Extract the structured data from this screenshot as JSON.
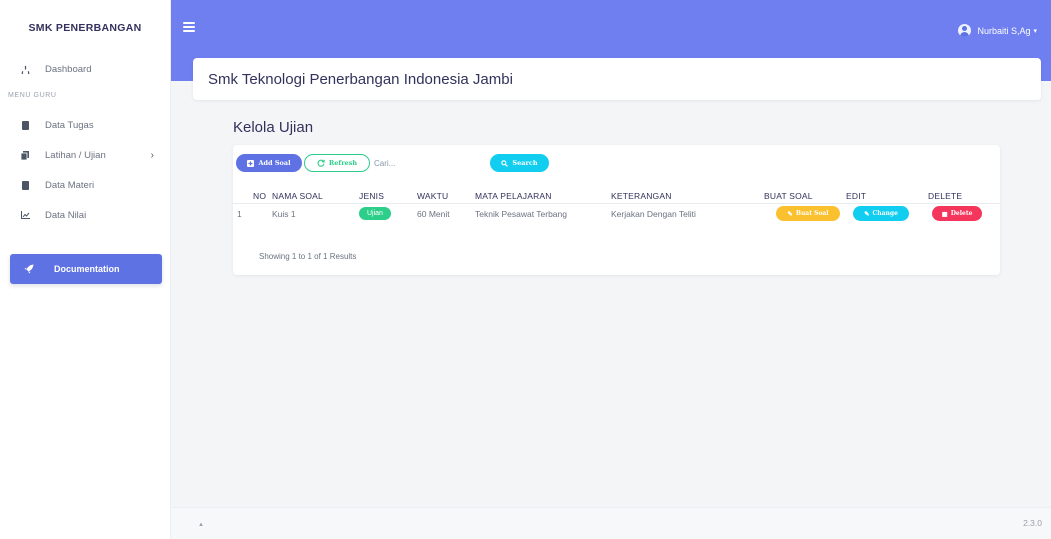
{
  "brand": "SMK PENERBANGAN",
  "sidebar": {
    "dashboard": "Dashboard",
    "heading": "MENU GURU",
    "items": [
      {
        "label": "Data Tugas",
        "icon": "book-icon"
      },
      {
        "label": "Latihan / Ujian",
        "icon": "copy-icon",
        "has_submenu": true
      },
      {
        "label": "Data Materi",
        "icon": "book-icon"
      },
      {
        "label": "Data Nilai",
        "icon": "chart-icon"
      }
    ],
    "documentation": "Documentation"
  },
  "topbar": {
    "user_name": "Nurbaiti S,Ag",
    "caret": "▾"
  },
  "header": {
    "title": "Smk Teknologi Penerbangan Indonesia Jambi"
  },
  "main": {
    "title": "Kelola Ujian",
    "toolbar": {
      "add_label": "Add Soal",
      "refresh_label": "Refresh",
      "search_placeholder": "Cari...",
      "search_label": "Search"
    },
    "columns": [
      "NO",
      "NAMA SOAL",
      "JENIS",
      "WAKTU",
      "MATA PELAJARAN",
      "KETERANGAN",
      "BUAT SOAL",
      "EDIT",
      "DELETE"
    ],
    "rows": [
      {
        "no": "1",
        "nama_soal": "Kuis 1",
        "jenis": "Ujian",
        "waktu": "60 Menit",
        "mata_pelajaran": "Teknik Pesawat Terbang",
        "keterangan": "Kerjakan Dengan Teliti",
        "buat_soal_label": "Buat Soal",
        "edit_label": "Change",
        "delete_label": "Delete"
      }
    ],
    "showing": "Showing 1 to 1 of 1 Results"
  },
  "footer": {
    "dot": "▲",
    "version": "2.3.0"
  },
  "colors": {
    "primary": "#5e72e4",
    "topbar": "#6f7ff0",
    "success": "#2dce89",
    "info": "#11cdef",
    "warning": "#fbc02d",
    "danger": "#f5365c"
  }
}
